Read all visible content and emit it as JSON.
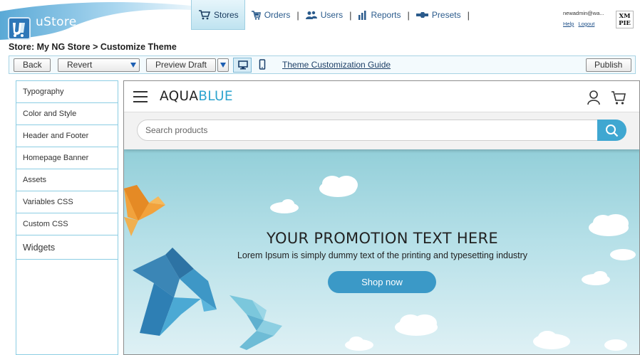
{
  "app": {
    "logo_text": "uStore"
  },
  "nav": {
    "items": [
      {
        "label": "Stores",
        "active": true
      },
      {
        "label": "Orders"
      },
      {
        "label": "Users"
      },
      {
        "label": "Reports"
      },
      {
        "label": "Presets"
      }
    ]
  },
  "user": {
    "name": "newadmin@wa...",
    "help": "Help",
    "logout": "Logout",
    "vendor_logo": "XMPIE"
  },
  "breadcrumb": "Store: My NG Store > Customize Theme",
  "toolbar": {
    "back": "Back",
    "revert": "Revert",
    "preview_draft": "Preview Draft",
    "guide": "Theme Customization Guide",
    "publish": "Publish",
    "icons": [
      "desktop-icon",
      "mobile-icon"
    ]
  },
  "sidebar": {
    "items": [
      {
        "label": "Typography"
      },
      {
        "label": "Color and Style"
      },
      {
        "label": "Header and Footer"
      },
      {
        "label": "Homepage Banner"
      },
      {
        "label": "Assets"
      },
      {
        "label": "Variables CSS"
      },
      {
        "label": "Custom CSS"
      },
      {
        "label": "Widgets"
      }
    ]
  },
  "preview": {
    "brand_dark": "AQUA",
    "brand_accent": "BLUE",
    "search_placeholder": "Search products",
    "promo_title": "YOUR PROMOTION TEXT HERE",
    "promo_sub": "Lorem Ipsum is simply dummy text of the printing and typesetting industry",
    "shop_button": "Shop now",
    "colors": {
      "accent": "#3fa7d1",
      "button": "#3b99c7",
      "sky_top": "#93cfd9",
      "sky_bottom": "#dff1f5"
    }
  }
}
